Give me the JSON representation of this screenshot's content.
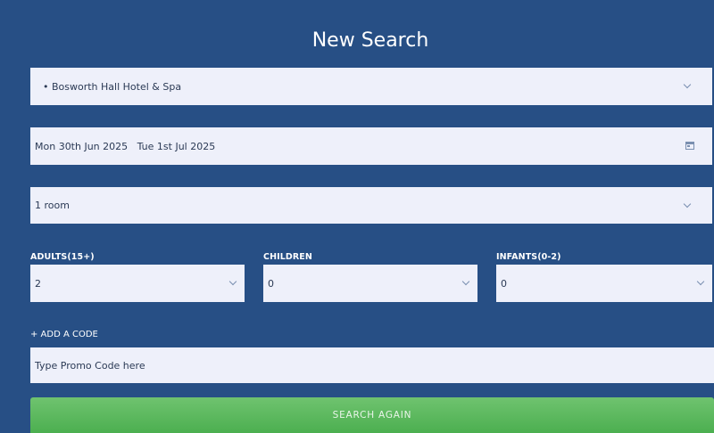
{
  "title": "New Search",
  "hotel": {
    "value": "• Bosworth Hall Hotel & Spa",
    "icon": "chevron-down-icon"
  },
  "dates": {
    "value": "Mon 30th Jun 2025   Tue 1st Jul 2025",
    "icon": "calendar-icon"
  },
  "rooms": {
    "value": "1 room",
    "icon": "chevron-down-icon"
  },
  "guests": {
    "adults": {
      "label": "ADULTS(15+)",
      "value": "2"
    },
    "children": {
      "label": "CHILDREN",
      "value": "0"
    },
    "infants": {
      "label": "INFANTS(0-2)",
      "value": "0"
    }
  },
  "promo": {
    "toggle_label": "+ ADD A CODE",
    "placeholder": "Type Promo Code here"
  },
  "submit": {
    "label": "SEARCH AGAIN"
  },
  "colors": {
    "background": "#274f85",
    "field": "#eef0fa",
    "button": "#5cb85c"
  }
}
